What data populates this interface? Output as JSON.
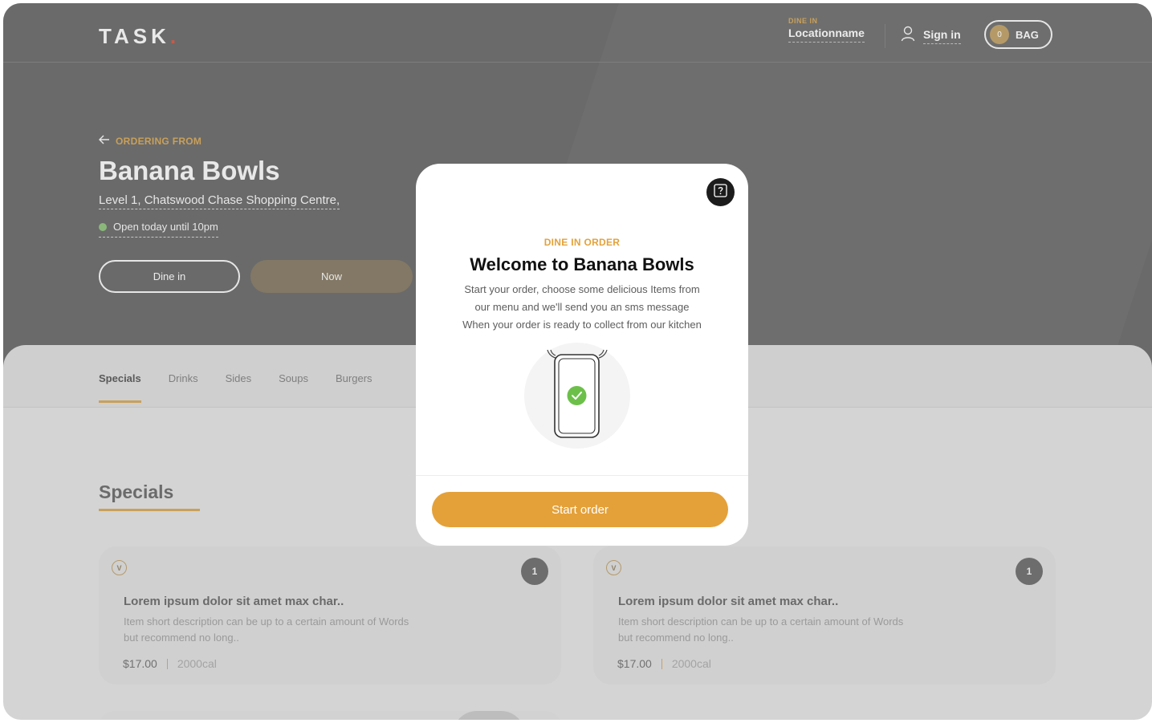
{
  "header": {
    "logo_text": "TASK",
    "logo_dot": ".",
    "dine_label": "DINE IN",
    "location_name": "Locationname",
    "sign_in": "Sign in",
    "bag_count": "0",
    "bag_label": "BAG"
  },
  "hero": {
    "ordering_from": "ORDERING FROM",
    "restaurant_name": "Banana Bowls",
    "address": "Level 1, Chatswood Chase Shopping Centre,",
    "hours": "Open today until 10pm",
    "dine_in_button": "Dine in",
    "now_button": "Now"
  },
  "tabs": [
    "Specials",
    "Drinks",
    "Sides",
    "Soups",
    "Burgers"
  ],
  "section_title": "Specials",
  "cards": [
    {
      "badge": "V",
      "quantity": "1",
      "title": "Lorem ipsum dolor sit amet max char..",
      "description": "Item short description can be up to a certain amount of Words but recommend no long..",
      "price": "$17.00",
      "calories": "2000cal"
    },
    {
      "badge": "V",
      "quantity": "1",
      "title": "Lorem ipsum dolor sit amet max char..",
      "description": "Item short description can be up to a certain amount of Words but recommend no long..",
      "price": "$17.00",
      "calories": "2000cal"
    }
  ],
  "modal": {
    "kicker": "DINE IN ORDER",
    "title": "Welcome to Banana Bowls",
    "body_lines": [
      "Start your order, choose some delicious Items from",
      "our menu and we'll send you an sms message",
      "When your order is ready to collect from our kitchen"
    ],
    "start_button": "Start order"
  },
  "colors": {
    "accent": "#e4a139",
    "overlay": "#6a6a6a",
    "status_green": "#8ab87a",
    "check_green": "#6cc04a"
  },
  "icons": [
    "arrow-left-icon",
    "user-icon",
    "help-icon",
    "phone-check-icon"
  ]
}
